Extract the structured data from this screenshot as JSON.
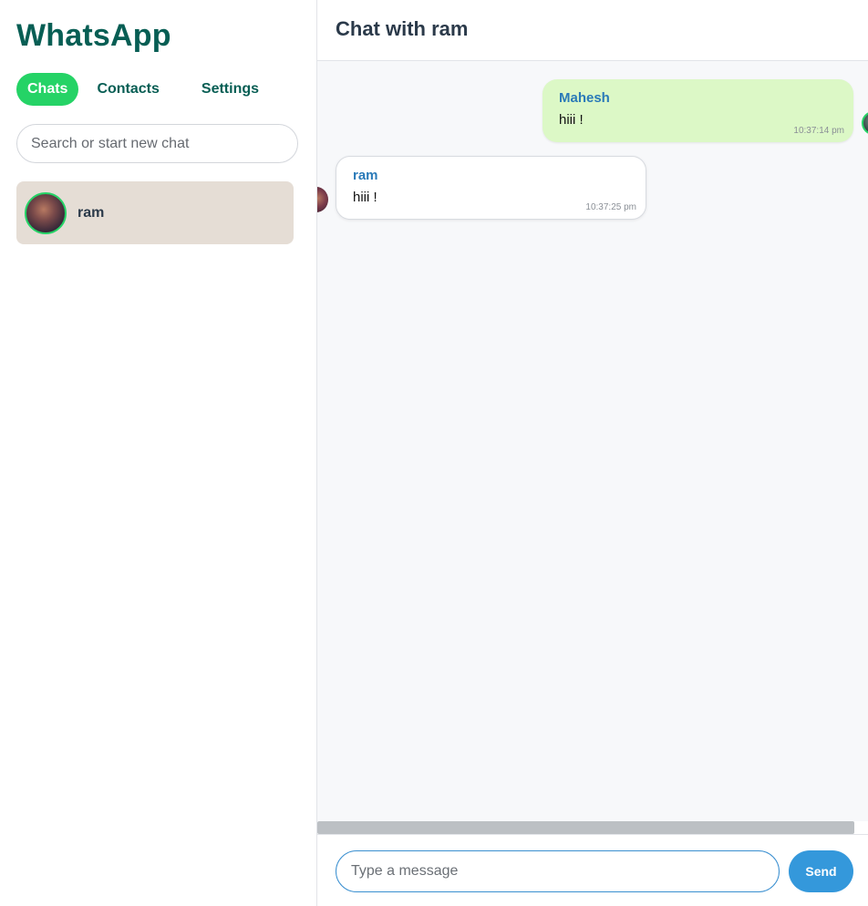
{
  "sidebar": {
    "app_title": "WhatsApp",
    "tabs": [
      {
        "label": "Chats",
        "active": true
      },
      {
        "label": "Contacts",
        "active": false
      },
      {
        "label": "Settings",
        "active": false
      }
    ],
    "search": {
      "placeholder": "Search or start new chat",
      "value": ""
    },
    "chats": [
      {
        "name": "ram",
        "avatar": "user-photo"
      }
    ]
  },
  "main": {
    "title": "Chat with ram",
    "messages": [
      {
        "sender": "Mahesh",
        "text": "hiii !",
        "time": "10:37:14 pm",
        "direction": "sent"
      },
      {
        "sender": "ram",
        "text": "hiii !",
        "time": "10:37:25 pm",
        "direction": "received"
      }
    ],
    "composer": {
      "placeholder": "Type a message",
      "value": "",
      "send_label": "Send"
    }
  },
  "colors": {
    "brand": "#075e54",
    "active_tab": "#25d366",
    "sent_bubble": "#dcf8c6",
    "send_button": "#3498db",
    "selected_chat": "#e5ddd5"
  }
}
